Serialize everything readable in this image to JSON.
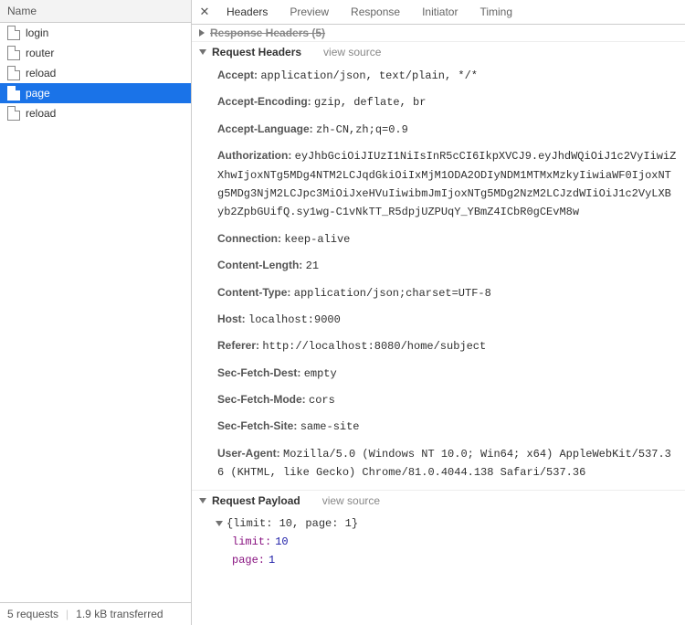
{
  "sidebar": {
    "header": "Name",
    "items": [
      {
        "label": "login",
        "selected": false
      },
      {
        "label": "router",
        "selected": false
      },
      {
        "label": "reload",
        "selected": false
      },
      {
        "label": "page",
        "selected": true
      },
      {
        "label": "reload",
        "selected": false
      }
    ],
    "footer": {
      "requests": "5 requests",
      "transferred": "1.9 kB transferred"
    }
  },
  "details": {
    "tabs": [
      {
        "label": "Headers",
        "active": true
      },
      {
        "label": "Preview",
        "active": false
      },
      {
        "label": "Response",
        "active": false
      },
      {
        "label": "Initiator",
        "active": false
      },
      {
        "label": "Timing",
        "active": false
      }
    ],
    "sections": {
      "responseHeaders": {
        "title": "Response Headers (5)"
      },
      "requestHeaders": {
        "title": "Request Headers",
        "viewSource": "view source",
        "rows": [
          {
            "name": "Accept:",
            "value": "application/json, text/plain, */*"
          },
          {
            "name": "Accept-Encoding:",
            "value": "gzip, deflate, br"
          },
          {
            "name": "Accept-Language:",
            "value": "zh-CN,zh;q=0.9"
          },
          {
            "name": "Authorization:",
            "value": "eyJhbGciOiJIUzI1NiIsInR5cCI6IkpXVCJ9.eyJhdWQiOiJ1c2VyIiwiZXhwIjoxNTg5MDg4NTM2LCJqdGkiOiIxMjM1ODA2ODIyNDM1MTMxMzkyIiwiaWF0IjoxNTg5MDg3NjM2LCJpc3MiOiJxeHVuIiwibmJmIjoxNTg5MDg2NzM2LCJzdWIiOiJ1c2VyLXByb2ZpbGUifQ.sy1wg-C1vNkTT_R5dpjUZPUqY_YBmZ4ICbR0gCEvM8w"
          },
          {
            "name": "Connection:",
            "value": "keep-alive"
          },
          {
            "name": "Content-Length:",
            "value": "21"
          },
          {
            "name": "Content-Type:",
            "value": "application/json;charset=UTF-8"
          },
          {
            "name": "Host:",
            "value": "localhost:9000"
          },
          {
            "name": "Referer:",
            "value": "http://localhost:8080/home/subject"
          },
          {
            "name": "Sec-Fetch-Dest:",
            "value": "empty"
          },
          {
            "name": "Sec-Fetch-Mode:",
            "value": "cors"
          },
          {
            "name": "Sec-Fetch-Site:",
            "value": "same-site"
          },
          {
            "name": "User-Agent:",
            "value": "Mozilla/5.0 (Windows NT 10.0; Win64; x64) AppleWebKit/537.36 (KHTML, like Gecko) Chrome/81.0.4044.138 Safari/537.36"
          }
        ]
      },
      "requestPayload": {
        "title": "Request Payload",
        "viewSource": "view source",
        "summary": "{limit: 10, page: 1}",
        "entries": [
          {
            "key": "limit:",
            "val": "10"
          },
          {
            "key": "page:",
            "val": "1"
          }
        ]
      }
    }
  }
}
